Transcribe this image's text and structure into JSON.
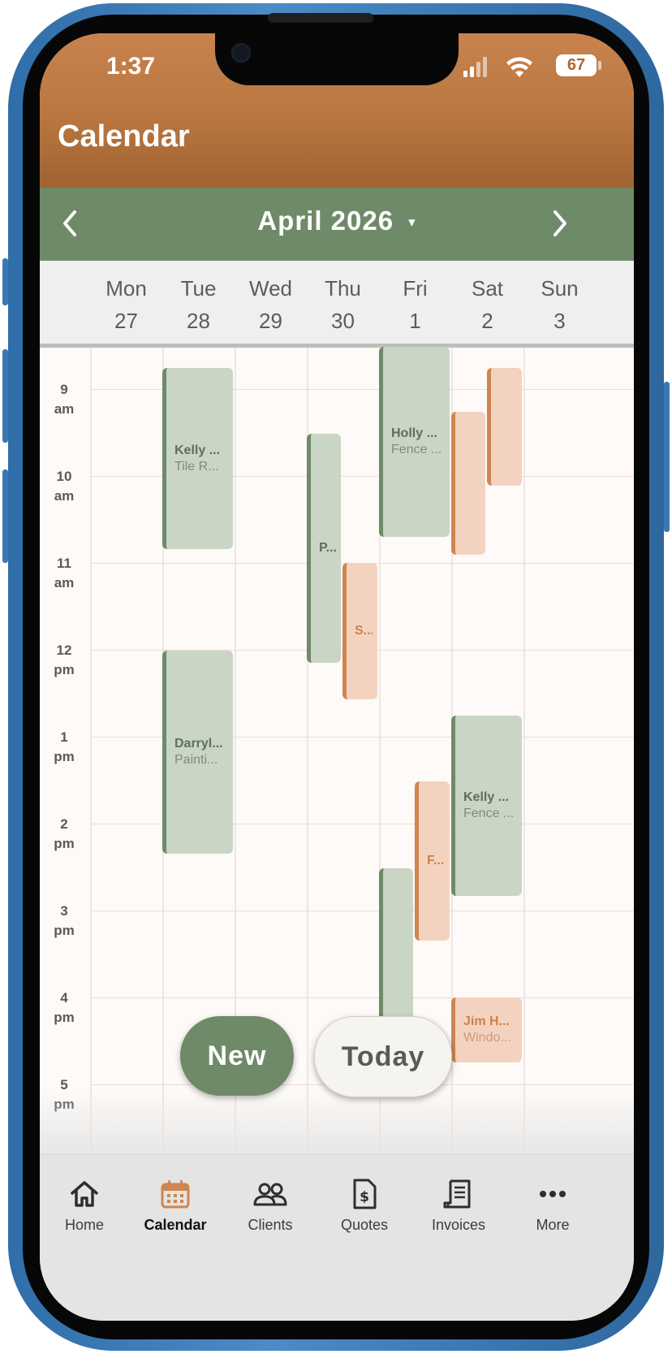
{
  "status_bar": {
    "time": "1:37",
    "battery": "67"
  },
  "header": {
    "title": "Calendar"
  },
  "month_bar": {
    "label": "April 2026",
    "caret": "▾"
  },
  "days": [
    {
      "name": "Mon",
      "num": "27"
    },
    {
      "name": "Tue",
      "num": "28"
    },
    {
      "name": "Wed",
      "num": "29"
    },
    {
      "name": "Thu",
      "num": "30"
    },
    {
      "name": "Fri",
      "num": "1"
    },
    {
      "name": "Sat",
      "num": "2"
    },
    {
      "name": "Sun",
      "num": "3"
    }
  ],
  "hours": [
    {
      "h": "9",
      "ap": "am"
    },
    {
      "h": "10",
      "ap": "am"
    },
    {
      "h": "11",
      "ap": "am"
    },
    {
      "h": "12",
      "ap": "pm"
    },
    {
      "h": "1",
      "ap": "pm"
    },
    {
      "h": "2",
      "ap": "pm"
    },
    {
      "h": "3",
      "ap": "pm"
    },
    {
      "h": "4",
      "ap": "pm"
    },
    {
      "h": "5",
      "ap": "pm"
    }
  ],
  "events": {
    "tue_1": {
      "title": "Kelly ...",
      "sub": "Tile R..."
    },
    "tue_2": {
      "title": "Darryl...",
      "sub": "Painti..."
    },
    "thu_1": {
      "title": "P..."
    },
    "thu_2": {
      "title": "S..."
    },
    "fri_1": {
      "title": "Holly ...",
      "sub": "Fence ..."
    },
    "fri_2": {
      "title": "F..."
    },
    "sat_1": {
      "title": "Kelly ...",
      "sub": "Fence ..."
    },
    "sat_2": {
      "title": "Jim H...",
      "sub": "Windo..."
    }
  },
  "colors": {
    "brand": "#b9773f",
    "accent_green": "#6f8a68",
    "event_green": "#c9d5c5",
    "event_orange": "#f3d3c0"
  },
  "buttons": {
    "new": "New",
    "today": "Today"
  },
  "tabs": [
    {
      "label": "Home",
      "icon": "home-icon"
    },
    {
      "label": "Calendar",
      "icon": "calendar-icon"
    },
    {
      "label": "Clients",
      "icon": "clients-icon"
    },
    {
      "label": "Quotes",
      "icon": "quote-icon"
    },
    {
      "label": "Invoices",
      "icon": "invoice-icon"
    },
    {
      "label": "More",
      "icon": "more-icon"
    }
  ]
}
